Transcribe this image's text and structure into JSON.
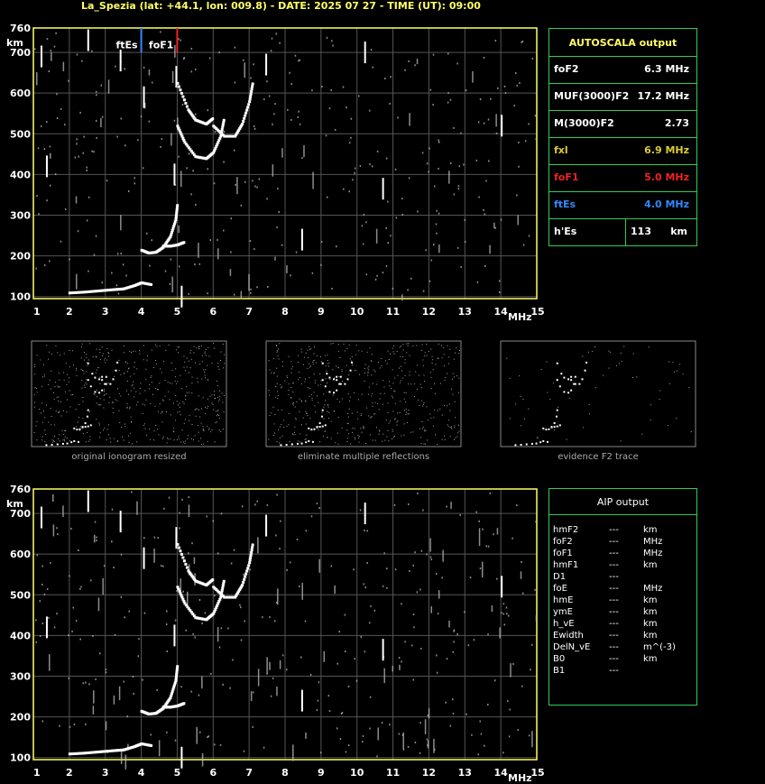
{
  "title": "La_Spezia (lat: +44.1, lon: 009.8) - DATE: 2025 07 27 - TIME (UT): 09:00",
  "colors": {
    "axis": "#ffff66",
    "grid": "#555555",
    "trace": "#ffffff",
    "panel": "#33cc55",
    "fxl": "#ddcc33",
    "foF1": "#ee2222",
    "ftEs": "#3388ff",
    "noise": "#bbbbbb"
  },
  "chart_data": [
    {
      "name": "main-ionogram",
      "type": "scatter",
      "xlabel": "MHz",
      "ylabel": "km",
      "x_ticks": [
        1,
        2,
        3,
        4,
        5,
        6,
        7,
        8,
        9,
        10,
        11,
        12,
        13,
        14,
        15
      ],
      "y_ticks": [
        100,
        200,
        300,
        400,
        500,
        600,
        700,
        760
      ],
      "xlim": [
        1,
        15
      ],
      "ylim": [
        95,
        760
      ],
      "grid": true,
      "markers": [
        {
          "label": "ftEs",
          "freq": 4.0,
          "color": "#3388ff"
        },
        {
          "label": "foF1",
          "freq": 5.0,
          "color": "#ee2222"
        }
      ],
      "traces": {
        "es_layer": [
          [
            2.0,
            110
          ],
          [
            2.4,
            112
          ],
          [
            2.8,
            115
          ],
          [
            3.2,
            118
          ],
          [
            3.5,
            120
          ],
          [
            3.8,
            128
          ],
          [
            4.0,
            135
          ],
          [
            4.3,
            130
          ]
        ],
        "f1_layer": [
          [
            4.0,
            215
          ],
          [
            4.2,
            208
          ],
          [
            4.4,
            210
          ],
          [
            4.6,
            222
          ],
          [
            4.8,
            248
          ],
          [
            4.95,
            290
          ],
          [
            5.0,
            330
          ]
        ],
        "f1_tail": [
          [
            4.6,
            225
          ],
          [
            4.8,
            225
          ],
          [
            5.0,
            228
          ],
          [
            5.2,
            235
          ]
        ],
        "f2_o": [
          [
            5.0,
            520
          ],
          [
            5.2,
            480
          ],
          [
            5.5,
            445
          ],
          [
            5.8,
            440
          ],
          [
            6.0,
            455
          ],
          [
            6.2,
            495
          ],
          [
            6.3,
            540
          ]
        ],
        "f2_x": [
          [
            6.0,
            520
          ],
          [
            6.3,
            495
          ],
          [
            6.6,
            495
          ],
          [
            6.8,
            525
          ],
          [
            7.0,
            580
          ],
          [
            7.1,
            630
          ]
        ],
        "f2_second": [
          [
            5.0,
            625
          ],
          [
            5.3,
            560
          ],
          [
            5.5,
            535
          ],
          [
            5.8,
            525
          ],
          [
            6.0,
            540
          ]
        ]
      }
    },
    {
      "name": "bottom-ionogram",
      "type": "scatter",
      "xlabel": "MHz",
      "ylabel": "km",
      "x_ticks": [
        1,
        2,
        3,
        4,
        5,
        6,
        7,
        8,
        9,
        10,
        11,
        12,
        13,
        14,
        15
      ],
      "y_ticks": [
        100,
        200,
        300,
        400,
        500,
        600,
        700,
        760
      ],
      "xlim": [
        1,
        15
      ],
      "ylim": [
        95,
        760
      ],
      "grid": true
    }
  ],
  "autoscala": {
    "header": "AUTOSCALA output",
    "rows": [
      {
        "label": "foF2",
        "value": "6.3 MHz",
        "color": "#ffffff"
      },
      {
        "label": "MUF(3000)F2",
        "value": "17.2 MHz",
        "color": "#ffffff"
      },
      {
        "label": "M(3000)F2",
        "value": "2.73",
        "color": "#ffffff"
      },
      {
        "label": "fxl",
        "value": "6.9 MHz",
        "color": "#ddcc33"
      },
      {
        "label": "foF1",
        "value": "5.0 MHz",
        "color": "#ee2222"
      },
      {
        "label": "ftEs",
        "value": "4.0 MHz",
        "color": "#3388ff"
      },
      {
        "label": "h'Es",
        "value": "113",
        "unit": "km",
        "color": "#ffffff"
      }
    ]
  },
  "thumbnails": [
    {
      "caption": "original ionogram resized"
    },
    {
      "caption": "eliminate multiple reflections"
    },
    {
      "caption": "evidence F2 trace"
    }
  ],
  "aip": {
    "header": "AIP output",
    "rows": [
      {
        "label": "hmF2",
        "value": "---",
        "unit": "km"
      },
      {
        "label": "foF2",
        "value": "---",
        "unit": "MHz"
      },
      {
        "label": "foF1",
        "value": "---",
        "unit": "MHz"
      },
      {
        "label": "hmF1",
        "value": "---",
        "unit": "km"
      },
      {
        "label": "D1",
        "value": "---",
        "unit": ""
      },
      {
        "label": "foE",
        "value": "---",
        "unit": "MHz"
      },
      {
        "label": "hmE",
        "value": "---",
        "unit": "km"
      },
      {
        "label": "ymE",
        "value": "---",
        "unit": "km"
      },
      {
        "label": "h_vE",
        "value": "---",
        "unit": "km"
      },
      {
        "label": "Ewidth",
        "value": "---",
        "unit": "km"
      },
      {
        "label": "DelN_vE",
        "value": "---",
        "unit": "m^(-3)"
      },
      {
        "label": "B0",
        "value": "---",
        "unit": "km"
      },
      {
        "label": "B1",
        "value": "---",
        "unit": ""
      }
    ]
  }
}
